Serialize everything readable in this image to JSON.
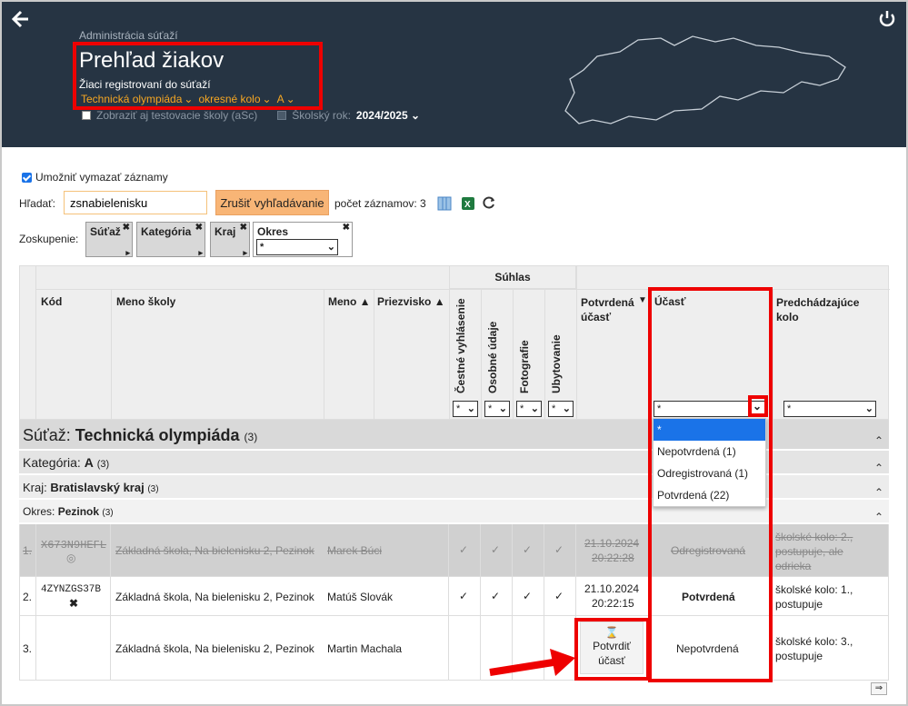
{
  "header": {
    "breadcrumb": "Administrácia súťaží",
    "title": "Prehľad žiakov",
    "subtitle": "Žiaci registrovaní do súťaží",
    "selectors": [
      "Technická olympiáda",
      "okresné kolo",
      "A"
    ],
    "test_schools_label": "Zobraziť aj testovacie školy (aSc)",
    "school_year_label": "Školský rok:",
    "school_year_value": "2024/2025"
  },
  "toolbar": {
    "allow_delete_label": "Umožniť vymazať záznamy",
    "search_label": "Hľadať:",
    "search_value": "zsnabielenisku",
    "clear_search_button": "Zrušiť vyhľadávanie",
    "record_count_label": "počet záznamov: 3"
  },
  "grouping": {
    "label": "Zoskupenie:",
    "chips": [
      "Súťaž",
      "Kategória",
      "Kraj",
      "Okres"
    ],
    "okres_filter_value": "*"
  },
  "table": {
    "consent_group": "Súhlas",
    "columns": {
      "code": "Kód",
      "school": "Meno školy",
      "first_name": "Meno",
      "last_name": "Priezvisko",
      "honest": "Čestné vyhlásenie",
      "personal": "Osobné údaje",
      "photos": "Fotografie",
      "lodging": "Ubytovanie",
      "confirmed": "Potvrdená účasť",
      "participation": "Účasť",
      "previous": "Predchádzajúce kolo"
    },
    "filters": {
      "star": "*"
    },
    "groups": {
      "contest_prefix": "Súťaž:",
      "contest_name": "Technická olympiáda",
      "contest_count": "(3)",
      "category_prefix": "Kategória:",
      "category_name": "A",
      "category_count": "(3)",
      "region_prefix": "Kraj:",
      "region_name": "Bratislavský kraj",
      "region_count": "(3)",
      "district_prefix": "Okres:",
      "district_name": "Pezinok",
      "district_count": "(3)"
    },
    "rows": [
      {
        "num": "1.",
        "code": "X673N9HEFL",
        "school": "Základná škola, Na bielenisku 2, Pezinok",
        "name": "Marek Búci",
        "date": "21.10.2024",
        "time": "20:22:28",
        "status": "Odregistrovaná",
        "previous": "školské kolo: 2., postupuje, ale odrieka"
      },
      {
        "num": "2.",
        "code": "4ZYNZGS37B",
        "school": "Základná škola, Na bielenisku 2, Pezinok",
        "name": "Matúš Slovák",
        "date": "21.10.2024",
        "time": "20:22:15",
        "status": "Potvrdená",
        "previous": "školské kolo: 1., postupuje"
      },
      {
        "num": "3.",
        "code": "",
        "school": "Základná škola, Na bielenisku 2, Pezinok",
        "name": "Martin Machala",
        "confirm_button": "Potvrdiť účasť",
        "status": "Nepotvrdená",
        "previous": "školské kolo: 3., postupuje"
      }
    ],
    "check": "✓"
  },
  "participation_dropdown": {
    "options": [
      "*",
      "Nepotvrdená (1)",
      "Odregistrovaná (1)",
      "Potvrdená (22)"
    ]
  },
  "colors": {
    "header_bg": "#263443",
    "accent": "#f5a623",
    "highlight": "#e00000"
  }
}
